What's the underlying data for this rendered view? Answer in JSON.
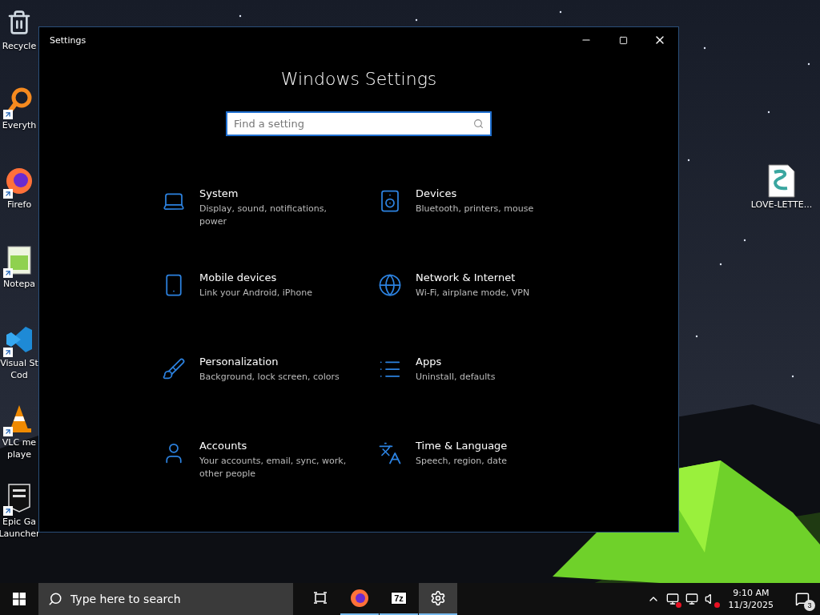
{
  "desktop_icons_left": [
    {
      "lines": [
        "Recycle"
      ],
      "shortcut": false
    },
    {
      "lines": [
        "Everyth"
      ],
      "shortcut": true
    },
    {
      "lines": [
        "Firefo"
      ],
      "shortcut": true
    },
    {
      "lines": [
        "Notepa"
      ],
      "shortcut": true
    },
    {
      "lines": [
        "Visual St",
        "Cod"
      ],
      "shortcut": true
    },
    {
      "lines": [
        "VLC me",
        "playe"
      ],
      "shortcut": true
    },
    {
      "lines": [
        "Epic Ga",
        "Launcher"
      ],
      "shortcut": true
    }
  ],
  "desktop_icons_right": [
    {
      "lines": [
        "LOVE-LETTE..."
      ],
      "shortcut": false
    }
  ],
  "window": {
    "title": "Settings",
    "heading": "Windows Settings",
    "search": {
      "placeholder": "Find a setting"
    },
    "categories": [
      {
        "name": "System",
        "description": "Display, sound, notifications, power"
      },
      {
        "name": "Devices",
        "description": "Bluetooth, printers, mouse"
      },
      {
        "name": "Mobile devices",
        "description": "Link your Android, iPhone"
      },
      {
        "name": "Network & Internet",
        "description": "Wi-Fi, airplane mode, VPN"
      },
      {
        "name": "Personalization",
        "description": "Background, lock screen, colors"
      },
      {
        "name": "Apps",
        "description": "Uninstall, defaults"
      },
      {
        "name": "Accounts",
        "description": "Your accounts, email, sync, work, other people"
      },
      {
        "name": "Time & Language",
        "description": "Speech, region, date"
      }
    ]
  },
  "taskbar": {
    "search": {
      "placeholder": "Type here to search"
    },
    "apps": [
      {
        "kind": "taskview",
        "running": false,
        "selected": false
      },
      {
        "kind": "firefox",
        "running": true,
        "selected": false
      },
      {
        "kind": "sevenzip",
        "label": "7z",
        "running": true,
        "selected": false
      },
      {
        "kind": "settings",
        "running": true,
        "selected": true
      }
    ],
    "clock": {
      "time": "9:10 AM",
      "date": "11/3/2025"
    },
    "notifications": {
      "count": "3"
    }
  }
}
